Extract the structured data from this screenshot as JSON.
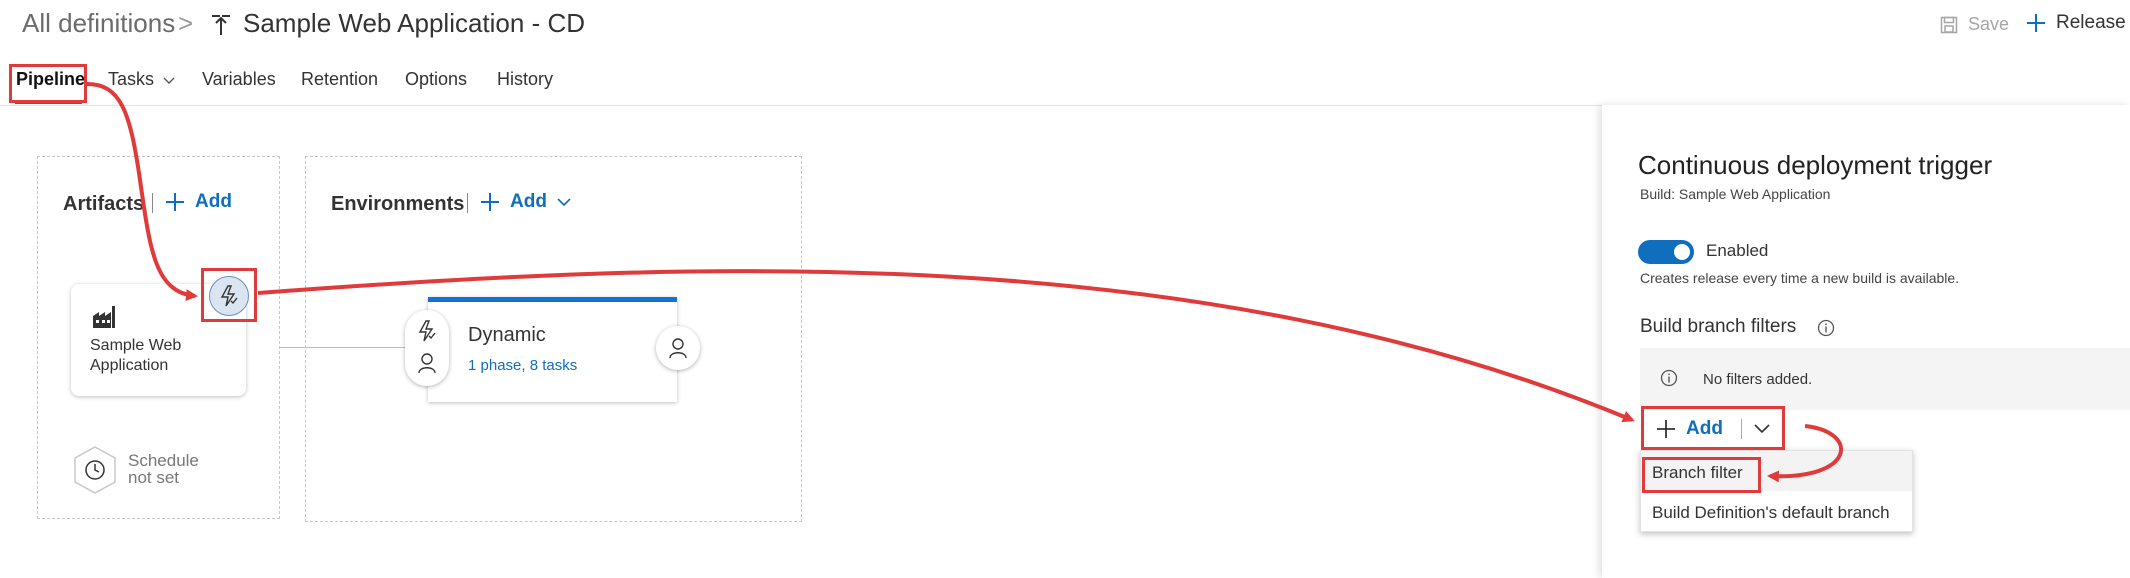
{
  "header": {
    "breadcrumb_root": "All definitions",
    "breadcrumb_separator": ">",
    "definition_title": "Sample Web Application - CD",
    "definition_icon": "release-definition-icon",
    "save_label": "Save",
    "release_label": "Release"
  },
  "tabs": [
    {
      "label": "Pipeline",
      "active": true
    },
    {
      "label": "Tasks"
    },
    {
      "label": "Variables"
    },
    {
      "label": "Retention"
    },
    {
      "label": "Options"
    },
    {
      "label": "History"
    }
  ],
  "artifacts": {
    "heading": "Artifacts",
    "add_label": "Add",
    "card_name": "Sample Web Application",
    "schedule_text_line1": "Schedule",
    "schedule_text_line2": "not set"
  },
  "environments": {
    "heading": "Environments",
    "add_label": "Add",
    "env_name": "Dynamic",
    "env_details": "1 phase, 8 tasks"
  },
  "trigger_panel": {
    "title": "Continuous deployment trigger",
    "subtitle": "Build: Sample Web Application",
    "toggle_label": "Enabled",
    "toggle_on": true,
    "description": "Creates release every time a new build is available.",
    "filters_title": "Build branch filters",
    "no_filters_text": "No filters added.",
    "add_label": "Add",
    "menu_items": [
      "Branch filter",
      "Build Definition's default branch"
    ]
  },
  "colors": {
    "accent": "#106ebe",
    "annotation_red": "#e03a3a",
    "env_top_border": "#1672d1"
  }
}
